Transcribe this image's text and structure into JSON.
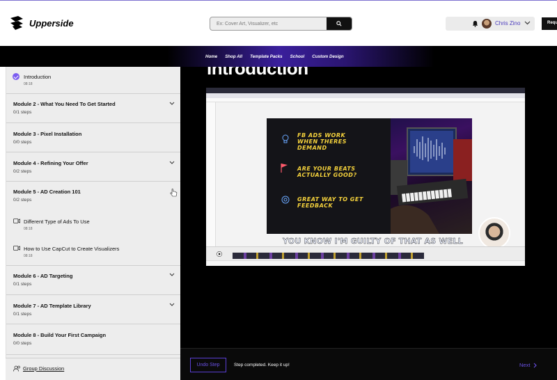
{
  "brand": {
    "name": "Upperside"
  },
  "search": {
    "placeholder": "Ex: Cover Art, Visualizer, etc",
    "value": ""
  },
  "user": {
    "name": "Chris Zino"
  },
  "header": {
    "cta_label": "Request"
  },
  "nav": {
    "items": [
      "Home",
      "Shop All",
      "Template Packs",
      "School",
      "Custom Design"
    ]
  },
  "sidebar": {
    "intro": {
      "title": "Introduction",
      "time": "08:18"
    },
    "modules": [
      {
        "title": "Module 2 - What You Need To Get Started",
        "steps": "0/1 steps"
      },
      {
        "title": "Module 3 - Pixel Installation",
        "steps": "0/0 steps"
      },
      {
        "title": "Module 4 - Refining Your Offer",
        "steps": "0/2 steps"
      },
      {
        "title": "Module 5 - AD Creation 101",
        "steps": "0/2 steps"
      },
      {
        "title": "Module 6 - AD Targeting",
        "steps": "0/1 steps"
      },
      {
        "title": "Module 7 - AD Template Library",
        "steps": "0/1 steps"
      },
      {
        "title": "Module 8 - Build Your First Campaign",
        "steps": "0/0 steps"
      }
    ],
    "lessons": [
      {
        "title": "Different Type of Ads To Use",
        "time": "08:18"
      },
      {
        "title": "How to Use CapCut to Create Visualizers",
        "time": "08:18"
      }
    ],
    "group_discussion": "Group Discussion"
  },
  "main": {
    "title": "Introduction",
    "slide": {
      "line1": "FB ADS WORK",
      "line2": "WHEN THERES",
      "line3": "DEMAND",
      "line4": "ARE YOUR BEATS",
      "line5": "ACTUALLY GOOD?",
      "line6": "GREAT WAY TO GET",
      "line7": "FEEDBACK"
    },
    "caption": "YOU KNOW I'M GUILTY OF THAT AS WELL",
    "undo_label": "Undo Step",
    "step_message": "Step completed. Keep it up!",
    "next_label": "Next"
  },
  "colors": {
    "accent": "#6b52e8",
    "nav_gradient": "#3a1f9c",
    "slide_text": "#f5d23c"
  }
}
